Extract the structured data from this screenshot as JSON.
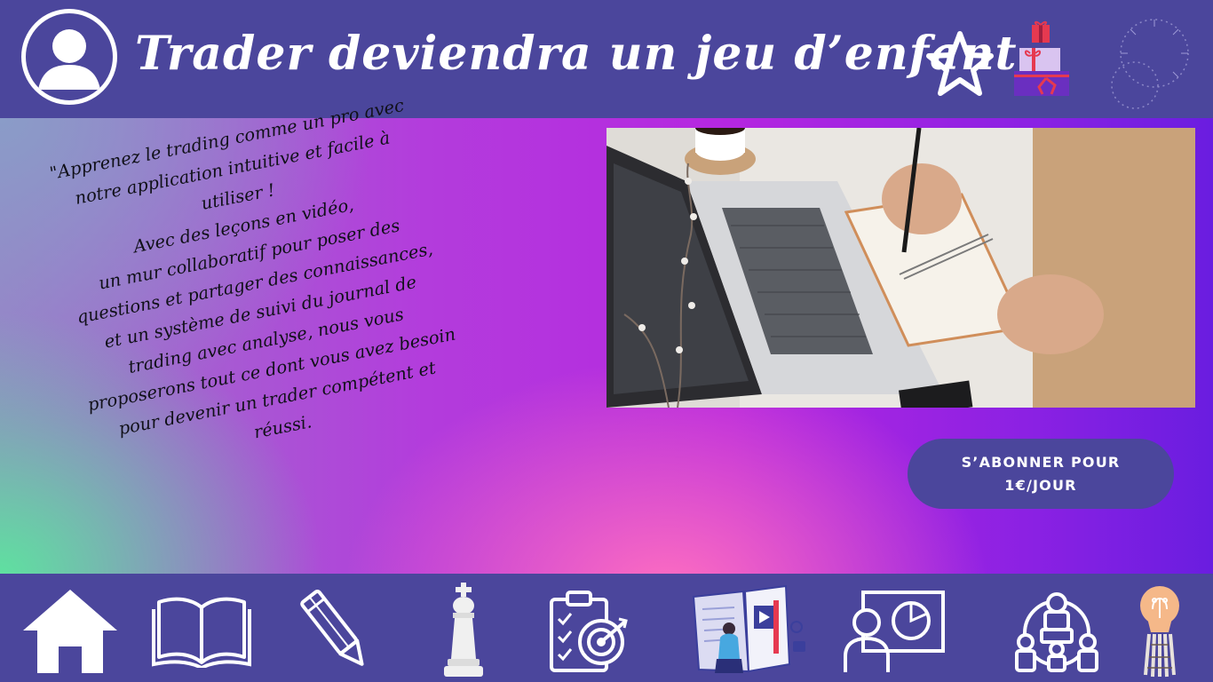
{
  "header": {
    "title": "Trader deviendra un jeu d’enfant",
    "avatar_icon": "user-avatar-icon",
    "star_icon": "star-icon",
    "gift_icon": "gift-boxes-icon",
    "decor_icon": "fireworks-icon"
  },
  "intro": {
    "lines": [
      "\"Apprenez le trading comme un pro avec",
      "notre application intuitive et facile à",
      "utiliser !",
      "Avec des leçons en vidéo,",
      "un mur collaboratif pour poser des",
      "questions et partager des connaissances,",
      "et un système de suivi du journal de",
      "trading avec analyse, nous vous",
      "proposerons tout ce dont vous avez besoin",
      "pour devenir un trader compétent et",
      "réussi."
    ]
  },
  "photo": {
    "subject": "laptop-and-notebook-photo"
  },
  "cta": {
    "line1": "S’ABONNER POUR",
    "line2": "1€/JOUR"
  },
  "nav": {
    "items": [
      {
        "name": "home",
        "icon": "home-icon"
      },
      {
        "name": "lessons",
        "icon": "open-book-icon"
      },
      {
        "name": "journal",
        "icon": "pencil-icon"
      },
      {
        "name": "strategy",
        "icon": "chess-king-icon"
      },
      {
        "name": "goals",
        "icon": "checklist-target-icon"
      },
      {
        "name": "video-lessons",
        "icon": "study-illustration-icon"
      },
      {
        "name": "analysis",
        "icon": "presentation-chart-icon"
      },
      {
        "name": "community",
        "icon": "collaboration-icon"
      },
      {
        "name": "ideas",
        "icon": "lightbulb-icon"
      }
    ]
  },
  "colors": {
    "primary": "#4b469c",
    "white": "#ffffff",
    "gradient_purple": "#b527e0",
    "gradient_green": "#5fe0a0",
    "gradient_pink": "#ff6fc0"
  }
}
